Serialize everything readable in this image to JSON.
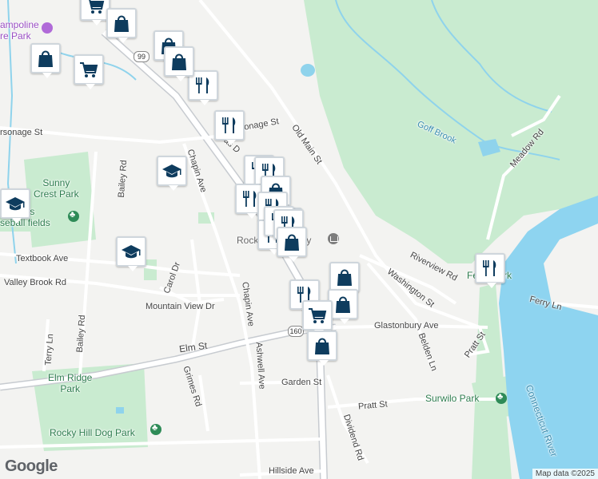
{
  "colors": {
    "background": "#f3f3f1",
    "park": "#c9ebd0",
    "water": "#8fd3ec",
    "river": "#8ed4f0",
    "road": "#ffffff",
    "highway": "#c7cbd0",
    "pin_icon": "#0e3c5e"
  },
  "places": {
    "trampoline_park": "ampoline\nre Park",
    "sunny_crest_park": "Sunny\nCrest Park",
    "stevens_baseball": "Stevens\nseball fields",
    "elm_ridge_park": "Elm Ridge\nPark",
    "dog_park": "Rocky Hill Dog Park",
    "library": "Rocky Hill Library",
    "ferry_park": "Ferry Park",
    "surwilo_park": "Surwilo Park"
  },
  "water_labels": {
    "goff_brook": "Goff Brook",
    "connecticut_river": "Connecticut River"
  },
  "streets": {
    "parsonage": "rsonage St",
    "parsonage_east": "onage St",
    "silas": "Silas D",
    "old_main": "Old Main St",
    "meadow": "Meadow Rd",
    "bailey_north": "Bailey Rd",
    "bailey_south": "Bailey Rd",
    "chapin_north": "Chapin Ave",
    "chapin_south": "Chapin Ave",
    "textbook": "Textbook Ave",
    "valley_brook": "Valley Brook Rd",
    "carol": "Carol Dr",
    "mountain_view": "Mountain View Dr",
    "riverview": "Riverview Rd",
    "washington": "Washington St",
    "glastonbury": "Glastonbury Ave",
    "belden": "Belden Ln",
    "pratt_east": "Pratt St",
    "pratt": "Pratt St",
    "ferry_ln": "Ferry Ln",
    "elm": "Elm St",
    "terry": "Terry Ln",
    "ashwell": "Ashwell Ave",
    "grimes": "Grimes Rd",
    "garden": "Garden St",
    "dividend": "Dividend Rd",
    "hillside": "Hillside Ave"
  },
  "route_shields": {
    "r99": "99",
    "r160": "160"
  },
  "icon_names": {
    "restaurant": "restaurant-icon",
    "shopping": "shopping-bag-icon",
    "grocery": "shopping-cart-icon",
    "school": "school-icon",
    "park": "park-tree-icon",
    "library": "library-icon"
  },
  "pins": [
    {
      "type": "grocery"
    },
    {
      "type": "shopping"
    },
    {
      "type": "shopping"
    },
    {
      "type": "grocery"
    },
    {
      "type": "shopping"
    },
    {
      "type": "restaurant"
    },
    {
      "type": "shopping"
    },
    {
      "type": "restaurant"
    },
    {
      "type": "restaurant"
    },
    {
      "type": "restaurant"
    },
    {
      "type": "restaurant"
    },
    {
      "type": "school"
    },
    {
      "type": "school"
    },
    {
      "type": "shopping"
    },
    {
      "type": "restaurant"
    },
    {
      "type": "restaurant"
    },
    {
      "type": "restaurant"
    },
    {
      "type": "restaurant"
    },
    {
      "type": "restaurant"
    },
    {
      "type": "shopping"
    },
    {
      "type": "school"
    },
    {
      "type": "shopping"
    },
    {
      "type": "restaurant"
    },
    {
      "type": "shopping"
    },
    {
      "type": "grocery"
    },
    {
      "type": "shopping"
    },
    {
      "type": "restaurant"
    }
  ],
  "attribution": {
    "logo": "Google",
    "map_data": "Map data ©2025"
  }
}
